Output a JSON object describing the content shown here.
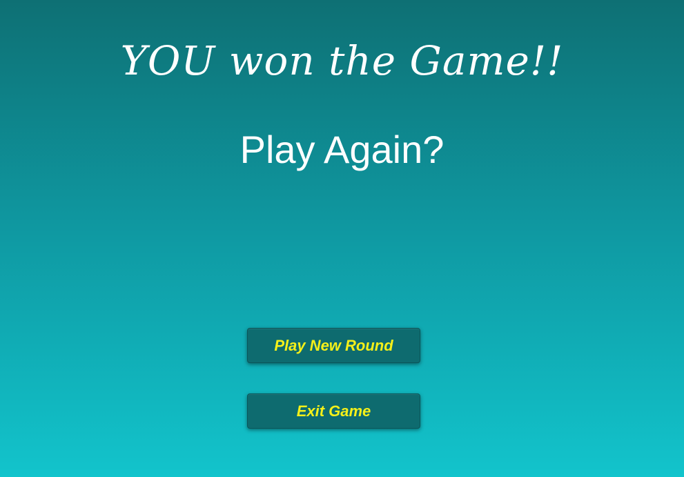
{
  "screen": {
    "win_message": "YOU won the Game!!",
    "prompt": "Play Again?"
  },
  "buttons": {
    "play_new_round_label": "Play New Round",
    "exit_game_label": "Exit Game"
  },
  "colors": {
    "background_top": "#0e7074",
    "background_bottom": "#12c4cc",
    "button_fill": "#0e6b6f",
    "button_text": "#f5f019",
    "title_text": "#ffffff"
  }
}
